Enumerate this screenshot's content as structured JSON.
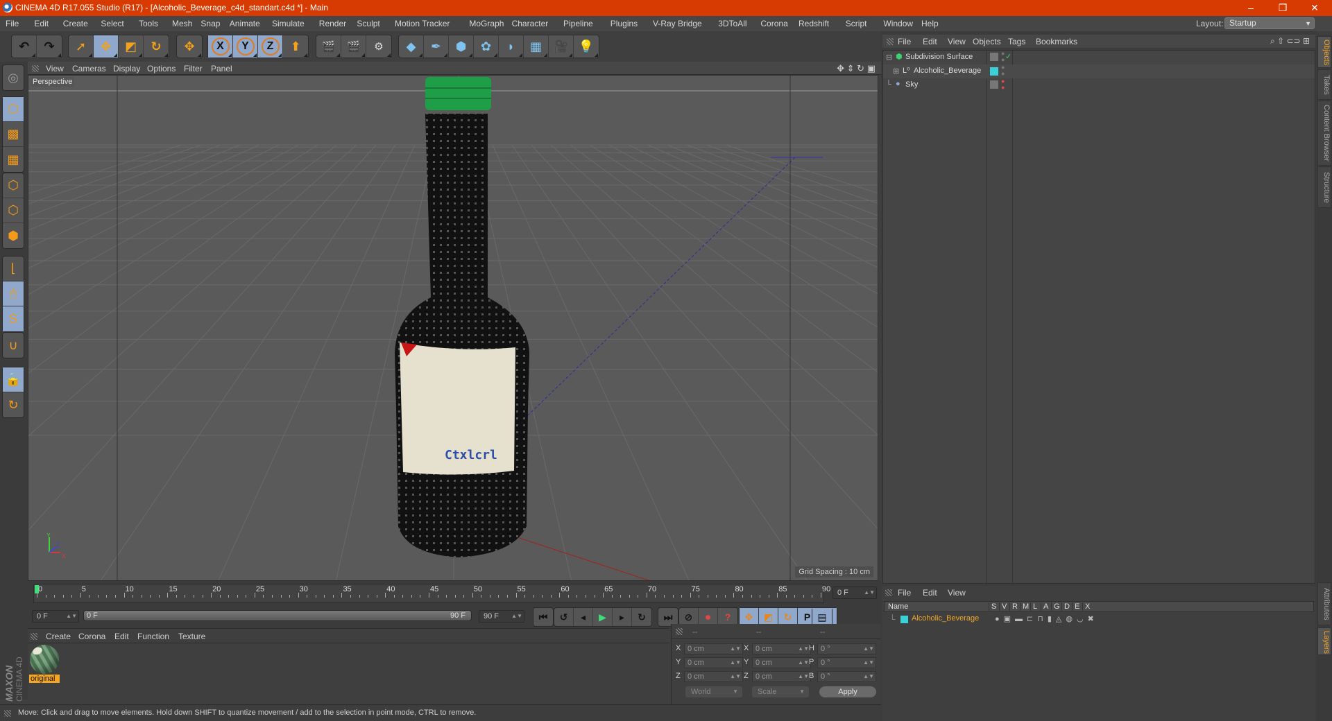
{
  "window": {
    "title": "CINEMA 4D R17.055 Studio (R17) - [Alcoholic_Beverage_c4d_standart.c4d *] - Main",
    "controls": {
      "minimize": "–",
      "restore": "❐",
      "close": "✕"
    }
  },
  "menubar": {
    "items": [
      "File",
      "Edit",
      "Create",
      "Select",
      "Tools",
      "Mesh",
      "Snap",
      "Animate",
      "Simulate",
      "Render",
      "Sculpt",
      "Motion Tracker",
      "MoGraph",
      "Character",
      "Pipeline",
      "Plugins",
      "V-Ray Bridge",
      "3DToAll",
      "Corona",
      "Redshift",
      "Script",
      "Window",
      "Help"
    ],
    "layout_label": "Layout:",
    "layout_value": "Startup"
  },
  "toolbar": {
    "groups": [
      {
        "name": "history",
        "buttons": [
          {
            "icon": "undo-icon",
            "glyph": "↶",
            "active": false
          },
          {
            "icon": "redo-icon",
            "glyph": "↷",
            "active": false
          }
        ]
      },
      {
        "name": "tools",
        "buttons": [
          {
            "icon": "live-selection-icon",
            "glyph": "➚",
            "active": false
          },
          {
            "icon": "move-icon",
            "glyph": "✥",
            "active": true
          },
          {
            "icon": "scale-icon",
            "glyph": "◩",
            "active": false
          },
          {
            "icon": "rotate-icon",
            "glyph": "↻",
            "active": false
          }
        ]
      },
      {
        "name": "recent",
        "buttons": [
          {
            "icon": "move-recent-icon",
            "glyph": "✥",
            "active": false
          }
        ]
      },
      {
        "name": "axes",
        "buttons": [
          {
            "icon": "x-axis-icon",
            "glyph": "X",
            "active": true
          },
          {
            "icon": "y-axis-icon",
            "glyph": "Y",
            "active": true
          },
          {
            "icon": "z-axis-icon",
            "glyph": "Z",
            "active": true
          },
          {
            "icon": "coordinate-system-icon",
            "glyph": "⬆",
            "active": false
          }
        ]
      },
      {
        "name": "render",
        "buttons": [
          {
            "icon": "render-view-icon",
            "glyph": "🎬",
            "active": false
          },
          {
            "icon": "render-picture-viewer-icon",
            "glyph": "🎬",
            "active": false
          },
          {
            "icon": "render-settings-icon",
            "glyph": "⚙",
            "active": false
          }
        ]
      },
      {
        "name": "create",
        "buttons": [
          {
            "icon": "cube-icon",
            "glyph": "◆",
            "active": false
          },
          {
            "icon": "pen-spline-icon",
            "glyph": "✒",
            "active": false
          },
          {
            "icon": "subdivision-icon",
            "glyph": "⬢",
            "active": false
          },
          {
            "icon": "cloner-icon",
            "glyph": "✿",
            "active": false
          },
          {
            "icon": "deformer-icon",
            "glyph": "◗",
            "active": false
          },
          {
            "icon": "floor-icon",
            "glyph": "▦",
            "active": false
          },
          {
            "icon": "camera-icon",
            "glyph": "🎥",
            "active": false
          },
          {
            "icon": "light-icon",
            "glyph": "💡",
            "active": false
          }
        ]
      }
    ]
  },
  "left_tools": [
    {
      "icon": "make-editable-icon",
      "active": false,
      "glyph": "◎"
    },
    {
      "icon": "model-mode-icon",
      "active": true,
      "glyph": "⬡"
    },
    {
      "icon": "texture-mode-icon",
      "active": false,
      "glyph": "▩"
    },
    {
      "icon": "workplane-mode-icon",
      "active": false,
      "glyph": "▦"
    },
    {
      "icon": "points-mode-icon",
      "active": false,
      "glyph": "⬡"
    },
    {
      "icon": "edges-mode-icon",
      "active": false,
      "glyph": "⬡"
    },
    {
      "icon": "polygons-mode-icon",
      "active": false,
      "glyph": "⬢"
    },
    {
      "icon": "axis-mode-icon",
      "active": false,
      "glyph": "⌊"
    },
    {
      "icon": "tweak-mode-icon",
      "active": true,
      "glyph": "🖱"
    },
    {
      "icon": "solo-mode-icon",
      "active": true,
      "glyph": "S"
    },
    {
      "icon": "snap-icon",
      "active": false,
      "glyph": "∪"
    },
    {
      "icon": "lock-workplane-icon",
      "active": true,
      "glyph": "🔒"
    },
    {
      "icon": "planar-workplane-icon",
      "active": false,
      "glyph": "↻"
    }
  ],
  "viewport": {
    "menu": [
      "View",
      "Cameras",
      "Display",
      "Options",
      "Filter",
      "Panel"
    ],
    "label": "Perspective",
    "grid_spacing": "Grid Spacing : 10 cm",
    "axis_labels": {
      "x": "X",
      "y": "Y",
      "z": "Z"
    },
    "nav_icons": [
      "move-view-icon",
      "zoom-view-icon",
      "rotate-view-icon",
      "maximize-view-icon"
    ]
  },
  "timeline": {
    "ticks": [
      "0",
      "5",
      "10",
      "15",
      "20",
      "25",
      "30",
      "35",
      "40",
      "45",
      "50",
      "55",
      "60",
      "65",
      "70",
      "75",
      "80",
      "85",
      "90"
    ],
    "current_frame_field": "0 F",
    "start_field": "0 F",
    "range_start": "0 F",
    "range_end": "90 F",
    "end_field": "90 F",
    "current_frame": 0,
    "max_frame": 90
  },
  "playback": {
    "buttons": [
      {
        "icon": "go-to-start-icon",
        "glyph": "⏮"
      },
      {
        "icon": "previous-key-icon",
        "glyph": "↺"
      },
      {
        "icon": "previous-frame-icon",
        "glyph": "◂"
      },
      {
        "icon": "play-icon",
        "glyph": "▶"
      },
      {
        "icon": "next-frame-icon",
        "glyph": "▸"
      },
      {
        "icon": "next-key-icon",
        "glyph": "↻"
      },
      {
        "icon": "go-to-end-icon",
        "glyph": "⏭"
      },
      {
        "icon": "record-keys-disabled-icon",
        "glyph": "⊘"
      },
      {
        "icon": "autokey-icon",
        "glyph": "⏺"
      },
      {
        "icon": "keyframe-selection-icon",
        "glyph": "?"
      },
      {
        "icon": "key-position-icon",
        "glyph": "✥"
      },
      {
        "icon": "key-scale-icon",
        "glyph": "◩"
      },
      {
        "icon": "key-rotation-icon",
        "glyph": "↻"
      },
      {
        "icon": "key-parameter-icon",
        "glyph": "P"
      },
      {
        "icon": "key-pla-icon",
        "glyph": "⁘"
      },
      {
        "icon": "timeline-window-icon",
        "glyph": "▤"
      }
    ]
  },
  "materials": {
    "menu": [
      "Create",
      "Corona",
      "Edit",
      "Function",
      "Texture"
    ],
    "items": [
      {
        "name": "original"
      }
    ]
  },
  "coordinates": {
    "headers": [
      "--",
      "--",
      "--"
    ],
    "rows": [
      {
        "l1": "X",
        "v1": "0 cm",
        "l2": "X",
        "v2": "0 cm",
        "l3": "H",
        "v3": "0 °"
      },
      {
        "l1": "Y",
        "v1": "0 cm",
        "l2": "Y",
        "v2": "0 cm",
        "l3": "P",
        "v3": "0 °"
      },
      {
        "l1": "Z",
        "v1": "0 cm",
        "l2": "Z",
        "v2": "0 cm",
        "l3": "B",
        "v3": "0 °"
      }
    ],
    "mode": "World",
    "transform": "Scale",
    "apply": "Apply"
  },
  "status": "Move: Click and drag to move elements. Hold down SHIFT to quantize movement / add to the selection in point mode, CTRL to remove.",
  "brand": {
    "maxon": "MAXON",
    "product": "CINEMA 4D"
  },
  "object_manager": {
    "menu": [
      "File",
      "Edit",
      "View",
      "Objects",
      "Tags",
      "Bookmarks"
    ],
    "objects": [
      {
        "name": "Subdivision Surface",
        "icon": "subdivision-surface-icon",
        "indent": 0,
        "expander": "⊟",
        "tag": "checkmark"
      },
      {
        "name": "Alcoholic_Beverage",
        "icon": "null-object-icon",
        "indent": 1,
        "expander": "⊞",
        "tag": "layer"
      },
      {
        "name": "Sky",
        "icon": "sky-icon",
        "indent": 0,
        "expander": "",
        "tag": "red-dot"
      }
    ],
    "tabs": [
      "Objects",
      "Takes",
      "Content Browser",
      "Structure"
    ]
  },
  "layer_manager": {
    "menu": [
      "File",
      "Edit",
      "View"
    ],
    "columns": [
      "Name",
      "S",
      "V",
      "R",
      "M",
      "L",
      "A",
      "G",
      "D",
      "E",
      "X"
    ],
    "layers": [
      {
        "name": "Alcoholic_Beverage",
        "color": "#3bcfd8"
      }
    ],
    "tabs": [
      "Attributes",
      "Layers"
    ]
  },
  "colors": {
    "titlebar": "#d83b01",
    "accent": "#f5a623",
    "active_button": "#8fa8cc",
    "layer_color": "#3bcfd8"
  }
}
